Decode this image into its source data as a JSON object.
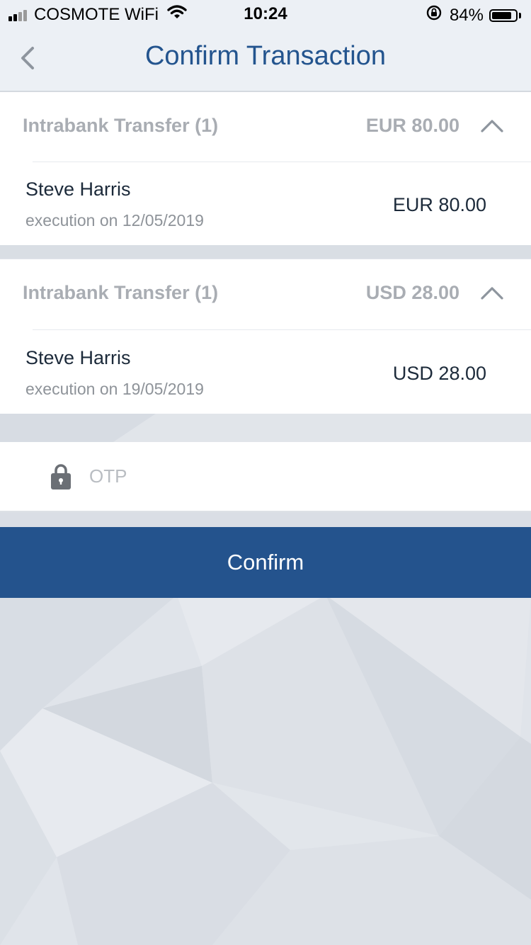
{
  "status_bar": {
    "carrier": "COSMOTE WiFi",
    "time": "10:24",
    "battery_percent": "84%",
    "battery_level": 0.84,
    "signal_bars": 4,
    "signal_bars_filled": 2
  },
  "header": {
    "title": "Confirm Transaction",
    "back_icon": "chevron-left-icon"
  },
  "transfer_groups": [
    {
      "title": "Intrabank Transfer (1)",
      "total": "EUR 80.00",
      "expanded": true,
      "items": [
        {
          "payee": "Steve Harris",
          "execution": "execution on 12/05/2019",
          "amount": "EUR 80.00"
        }
      ]
    },
    {
      "title": "Intrabank Transfer (1)",
      "total": "USD 28.00",
      "expanded": true,
      "items": [
        {
          "payee": "Steve Harris",
          "execution": "execution on 19/05/2019",
          "amount": "USD 28.00"
        }
      ]
    }
  ],
  "otp": {
    "placeholder": "OTP",
    "value": "",
    "icon": "lock-icon"
  },
  "confirm": {
    "label": "Confirm"
  },
  "colors": {
    "brand_blue": "#24538d",
    "title_blue": "#23548e",
    "header_bg": "#ecf0f5",
    "muted_text": "#a9adb3"
  }
}
